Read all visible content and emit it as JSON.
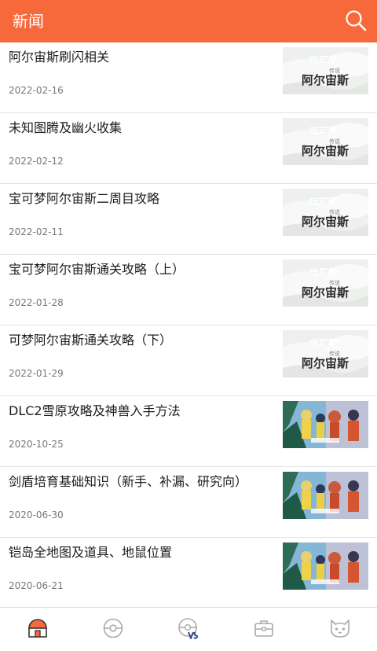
{
  "header": {
    "title": "新闻",
    "search_icon": "search-icon"
  },
  "news": [
    {
      "title": "阿尔宙斯刷闪相关",
      "date": "2022-02-16",
      "thumb": "arceus-logo"
    },
    {
      "title": "未知图腾及幽火收集",
      "date": "2022-02-12",
      "thumb": "arceus-logo"
    },
    {
      "title": "宝可梦阿尔宙斯二周目攻略",
      "date": "2022-02-11",
      "thumb": "arceus-logo"
    },
    {
      "title": "宝可梦阿尔宙斯通关攻略（上）",
      "date": "2022-01-28",
      "thumb": "arceus-logo"
    },
    {
      "title": "可梦阿尔宙斯通关攻略（下）",
      "date": "2022-01-29",
      "thumb": "arceus-logo"
    },
    {
      "title": "DLC2雪原攻略及神兽入手方法",
      "date": "2020-10-25",
      "thumb": "sword-shield-art"
    },
    {
      "title": "剑盾培育基础知识（新手、补漏、研究向）",
      "date": "2020-06-30",
      "thumb": "sword-shield-art"
    },
    {
      "title": "铠岛全地图及道具、地鼠位置",
      "date": "2020-06-21",
      "thumb": "sword-shield-art"
    }
  ],
  "logo_text": {
    "line1": "宝可梦",
    "line2": "传说",
    "line3": "阿尔宙斯"
  },
  "tabs": [
    {
      "icon": "home-icon",
      "active": true
    },
    {
      "icon": "pokeball-icon",
      "active": false
    },
    {
      "icon": "versus-icon",
      "active": false
    },
    {
      "icon": "bag-icon",
      "active": false
    },
    {
      "icon": "cat-face-icon",
      "active": false
    }
  ],
  "colors": {
    "accent": "#f7693a",
    "tab_inactive": "#a9a9a9"
  }
}
